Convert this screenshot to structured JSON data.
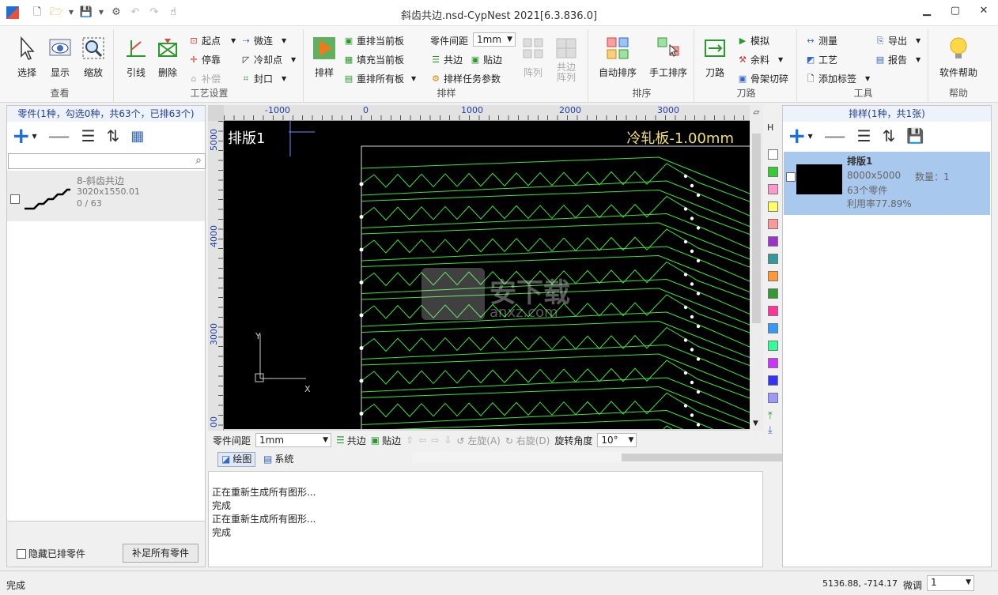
{
  "window": {
    "title": "斜齿共边.nsd-CypNest 2021[6.3.836.0]"
  },
  "ribbon": {
    "view": {
      "label": "查看",
      "select": "选择",
      "display": "显示",
      "zoom": "缩放"
    },
    "process": {
      "label": "工艺设置",
      "lead": "引线",
      "delete": "删除",
      "start": "起点",
      "stop": "停靠",
      "compensate": "补偿",
      "microjoint": "微连",
      "cooling": "冷却点",
      "seal": "封口"
    },
    "nest": {
      "label": "排样",
      "nest": "排样",
      "renest_current": "重排当前板",
      "fill_current": "填充当前板",
      "renest_all": "重排所有板",
      "part_spacing": "零件间距",
      "spacing_value": "1mm",
      "common_edge": "共边",
      "edge_snap": "贴边",
      "task_params": "排样任务参数",
      "array": "阵列",
      "common_array": "共边\n阵列"
    },
    "sort": {
      "label": "排序",
      "auto": "自动排序",
      "manual": "手工排序"
    },
    "path": {
      "label": "刀路",
      "path": "刀路",
      "simulate": "模拟",
      "remnant": "余料",
      "skeleton": "骨架切碎"
    },
    "tools": {
      "label": "工具",
      "measure": "测量",
      "craft": "工艺",
      "add_label": "添加标签",
      "export": "导出",
      "report": "报告"
    },
    "help": {
      "label": "帮助",
      "software_help": "软件帮助"
    }
  },
  "parts_panel": {
    "header": "零件(1种，勾选0种，共63个，已排63个)",
    "search_placeholder": "",
    "items": [
      {
        "name": "8-斜齿共边",
        "size": "3020x1550.01",
        "count": "0 / 63"
      }
    ],
    "hide_nested": "隐藏已排零件",
    "fill_all": "补足所有零件"
  },
  "canvas": {
    "sheet_name": "排版1",
    "material": "冷轧板-1.00mm",
    "h_ruler": [
      "-1000",
      "0",
      "1000",
      "2000",
      "3000"
    ],
    "v_ruler": [
      "5000",
      "4000",
      "3000",
      "00"
    ],
    "axis_x": "X",
    "axis_y": "Y",
    "watermark": "安下载",
    "watermark_sub": "anxz.com"
  },
  "bottom_toolbar": {
    "part_spacing": "零件间距",
    "spacing_value": "1mm",
    "common_edge": "共边",
    "edge_snap": "贴边",
    "rotate_left": "左旋(A)",
    "rotate_right": "右旋(D)",
    "rotate_angle": "旋转角度",
    "angle_value": "10°"
  },
  "tabs": {
    "drawing": "绘图",
    "system": "系统"
  },
  "log": {
    "lines": [
      "正在重新生成所有图形...",
      "完成",
      "正在重新生成所有图形...",
      "完成"
    ]
  },
  "sheets_panel": {
    "header": "排样(1种，共1张)",
    "items": [
      {
        "name": "排版1",
        "size": "8000x5000",
        "qty": "数量：1",
        "parts": "63个零件",
        "util": "利用率77.89%"
      }
    ]
  },
  "colors": {
    "swatches": [
      "#ffffff",
      "#33cc33",
      "#ff99cc",
      "#ffff66",
      "#ff9999",
      "#9933cc",
      "#339999",
      "#ff9933",
      "#339933",
      "#ff3399",
      "#3399ff",
      "#33ff99",
      "#cc33ff",
      "#3333ff",
      "#9999ff"
    ],
    "part_line": "#39e639",
    "canvas_bg": "#000000",
    "sheet_border": "#ffffff"
  },
  "status": {
    "text": "完成",
    "coords": "5136.88, -714.17",
    "fine_label": "微调",
    "fine_value": "1"
  }
}
